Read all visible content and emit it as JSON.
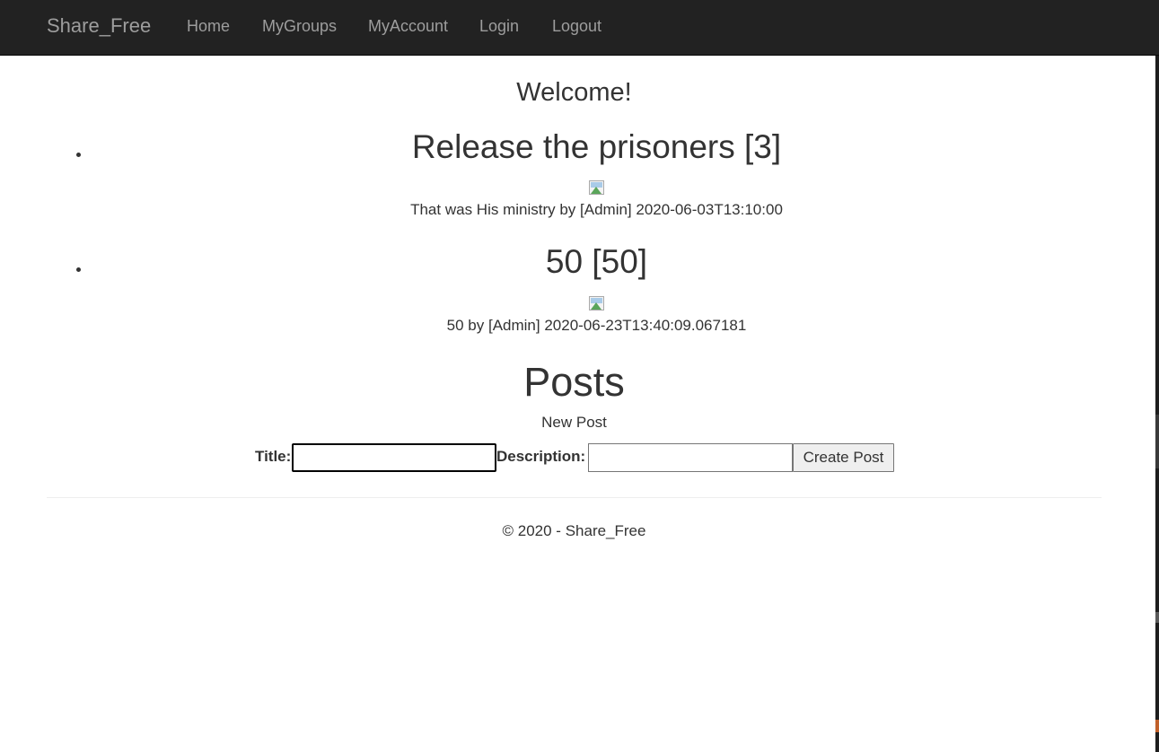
{
  "navbar": {
    "brand": "Share_Free",
    "links": [
      "Home",
      "MyGroups",
      "MyAccount",
      "Login",
      "Logout"
    ]
  },
  "main": {
    "welcome": "Welcome!",
    "posts": [
      {
        "title": "Release the prisoners [3]",
        "meta": "That was His ministry by [Admin] 2020-06-03T13:10:00",
        "image_icon": "broken-image-icon"
      },
      {
        "title": "50 [50]",
        "meta": "50 by [Admin] 2020-06-23T13:40:09.067181",
        "image_icon": "broken-image-icon"
      }
    ],
    "posts_heading": "Posts",
    "new_post_label": "New Post",
    "form": {
      "title_label": "Title:",
      "title_value": "",
      "description_label": "Description:",
      "description_value": "",
      "submit_label": "Create Post"
    }
  },
  "footer": {
    "text": "© 2020 - Share_Free"
  },
  "colors": {
    "navbar_bg": "#222222",
    "nav_text": "#9d9d9d",
    "body_text": "#333333"
  }
}
